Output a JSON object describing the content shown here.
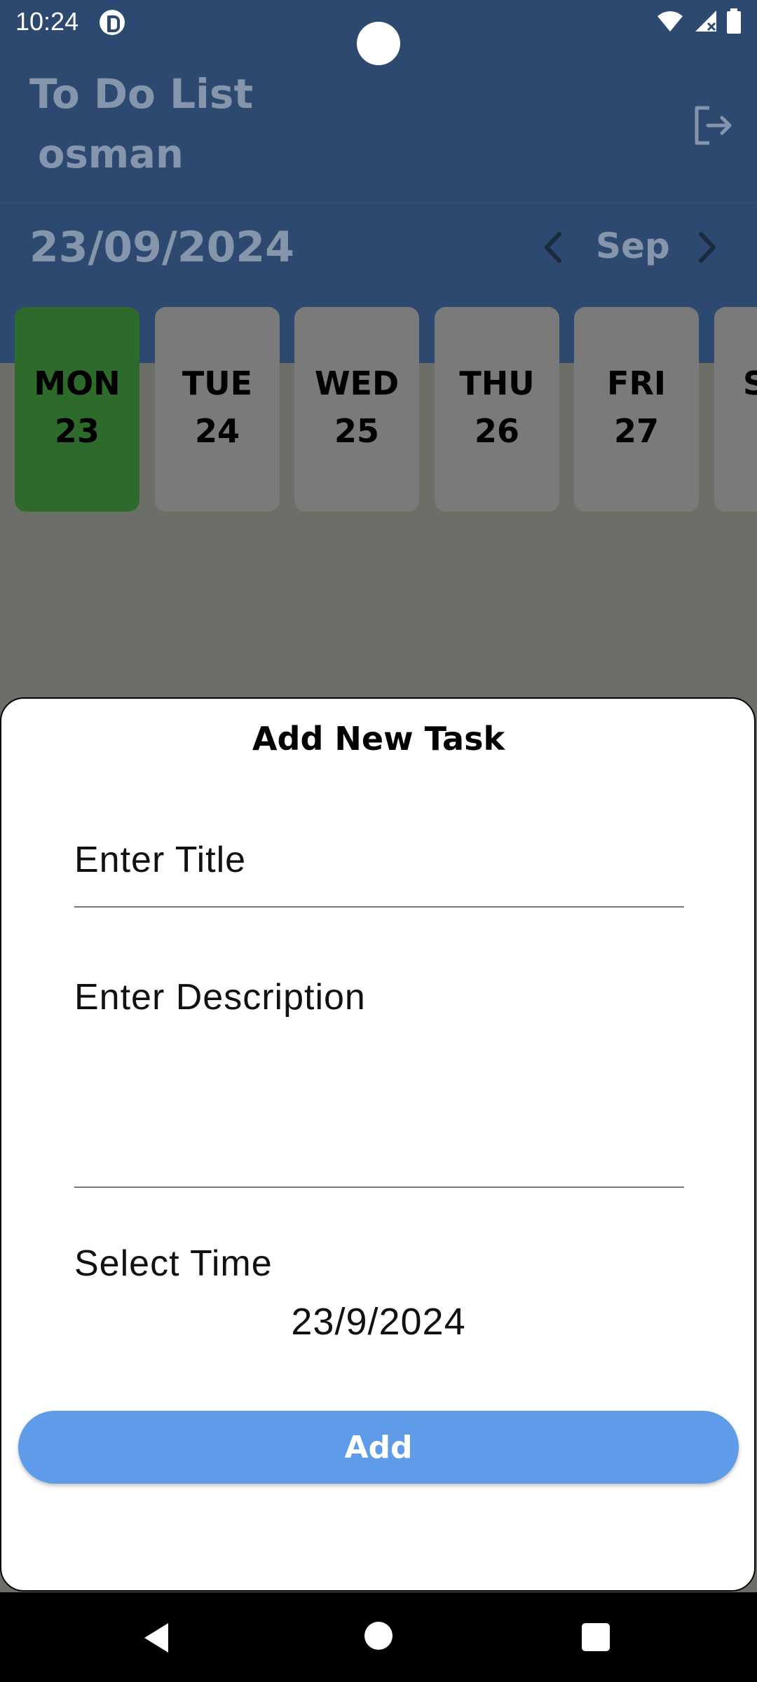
{
  "status_bar": {
    "time": "10:24",
    "icons": [
      "app-notification-icon",
      "wifi-icon",
      "signal-icon",
      "battery-icon"
    ]
  },
  "header": {
    "title": "To Do List",
    "user": "osman",
    "logout_icon": "logout-icon",
    "date": "23/09/2024",
    "month": "Sep",
    "prev_icon": "chevron-left-icon",
    "next_icon": "chevron-right-icon"
  },
  "days": [
    {
      "name": "MON",
      "num": "23",
      "selected": true
    },
    {
      "name": "TUE",
      "num": "24",
      "selected": false
    },
    {
      "name": "WED",
      "num": "25",
      "selected": false
    },
    {
      "name": "THU",
      "num": "26",
      "selected": false
    },
    {
      "name": "FRI",
      "num": "27",
      "selected": false
    },
    {
      "name": "S",
      "num": "",
      "selected": false
    }
  ],
  "sheet": {
    "title": "Add New Task",
    "title_placeholder": "Enter Title",
    "description_placeholder": "Enter Description",
    "time_label": "Select Time",
    "time_value": "23/9/2024",
    "add_label": "Add"
  },
  "colors": {
    "header": "#2e4970",
    "selected_day": "#2e6a2c",
    "add_button": "#5e9be8",
    "scrim": "#6c6f67"
  },
  "nav_bar": {
    "icons": [
      "back-icon",
      "home-icon",
      "recents-icon"
    ]
  }
}
